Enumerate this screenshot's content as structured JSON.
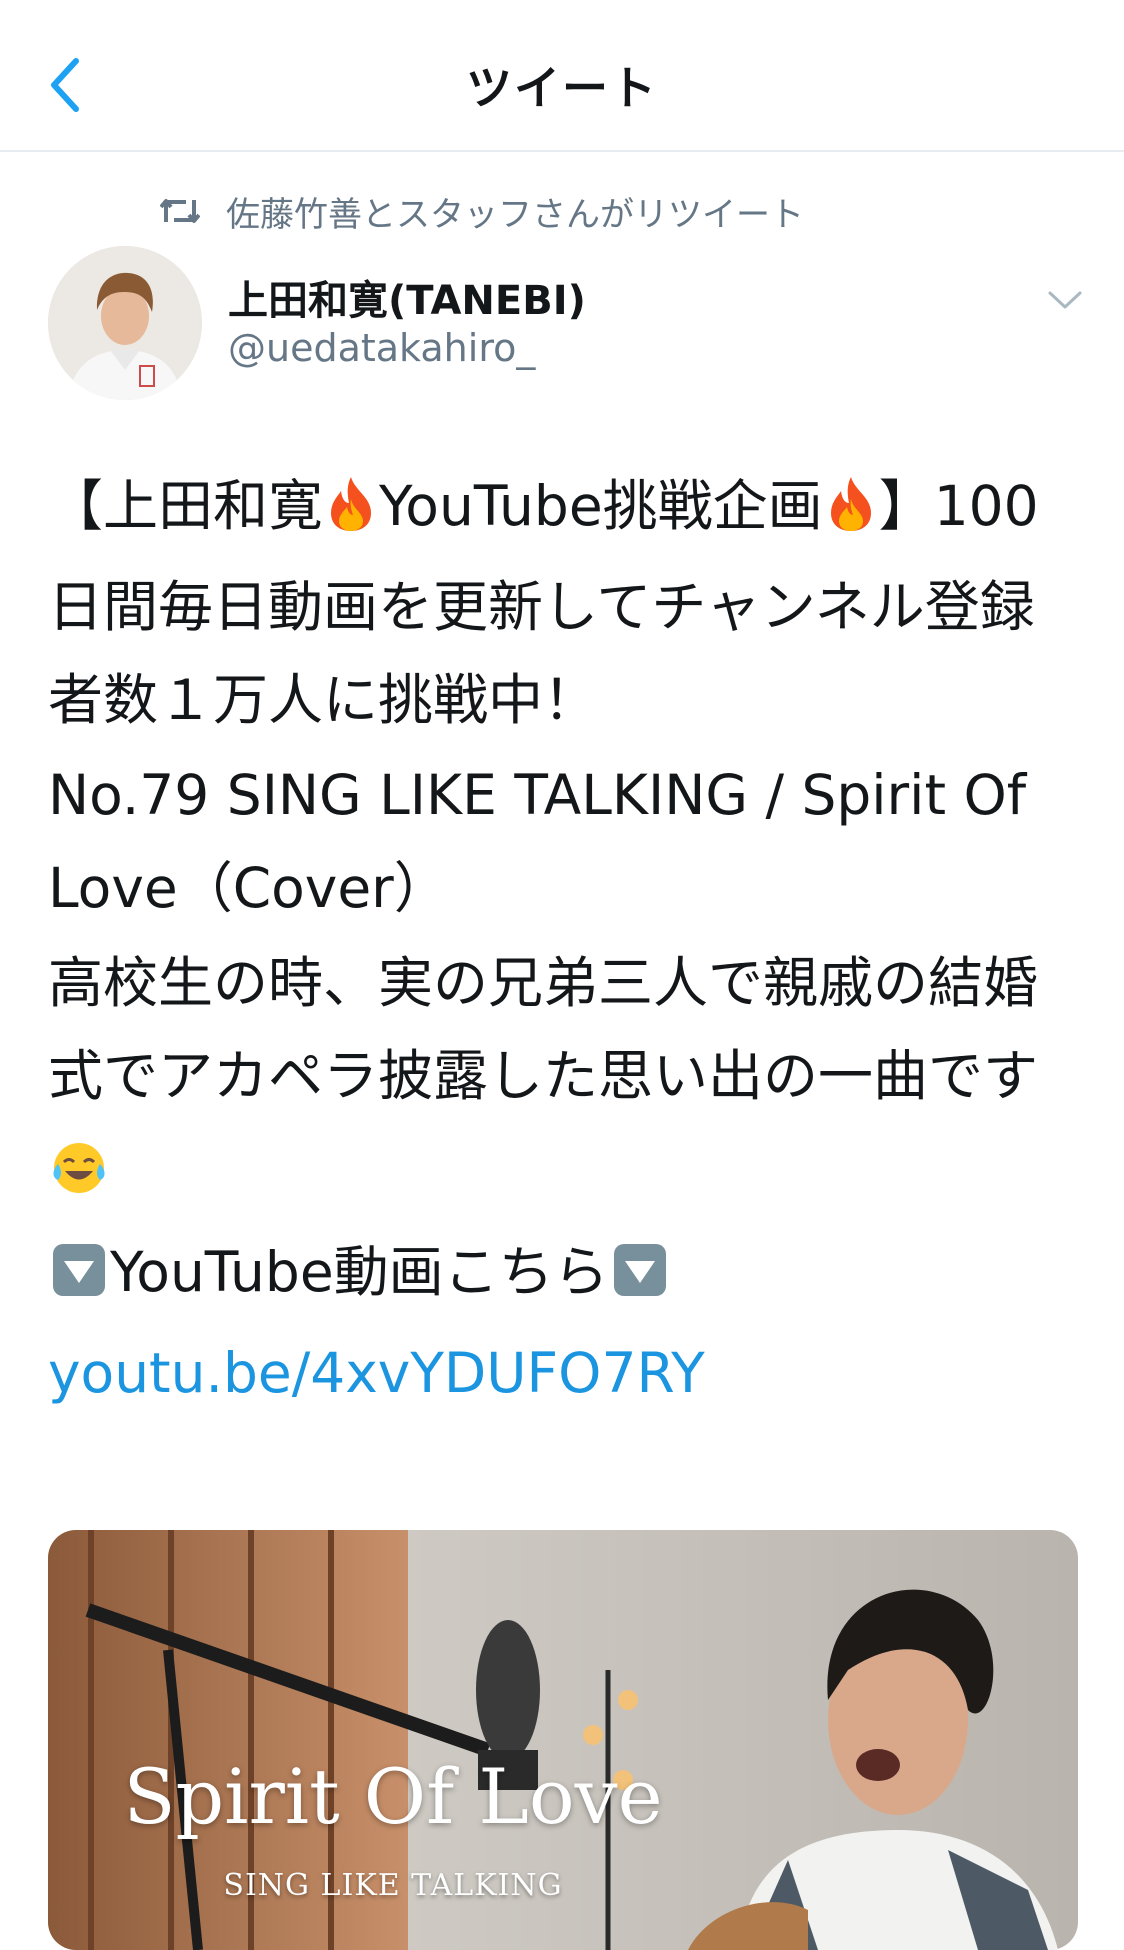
{
  "nav": {
    "title": "ツイート"
  },
  "retweet": {
    "text": "佐藤竹善とスタッフさんがリツイート"
  },
  "author": {
    "name": "上田和寛(TANEBI)",
    "handle": "@uedatakahiro_"
  },
  "tweet": {
    "line1_a": "【上田和寛",
    "line1_b": "YouTube挑戦企画",
    "line1_c": "】",
    "line1_rest": "100日間毎日動画を更新してチャンネル登録者数１万人に挑戦中！",
    "song": "No.79 SING LIKE TALKING / Spirit Of Love（Cover）",
    "story": "高校生の時、実の兄弟三人で親戚の結婚式でアカペラ披露した思い出の一曲です",
    "youtube_label": "YouTube動画こちら",
    "link": "youtu.be/4xvYDUFO7RY"
  },
  "media": {
    "title": "Spirit Of Love",
    "subtitle": "SING LIKE TALKING"
  },
  "colors": {
    "link": "#1b95e0",
    "secondary": "#657786",
    "border": "#e6ecf0"
  }
}
